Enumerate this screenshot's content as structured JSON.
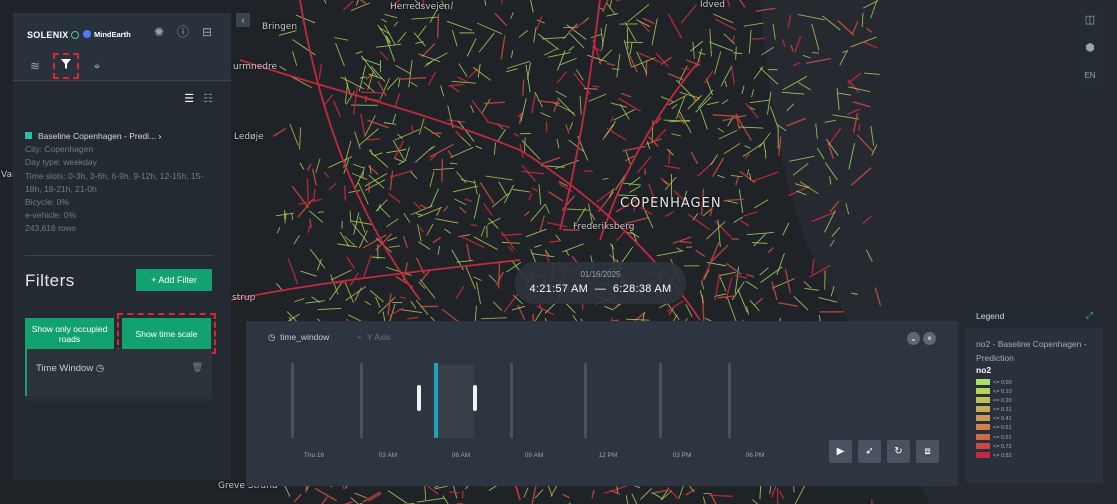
{
  "brand": {
    "name": "SOLENIX",
    "partner": "MindEarth"
  },
  "map": {
    "labels": [
      "Herredsvejen",
      "Bringen",
      "urmnedre",
      "Ledøje",
      "Valby",
      "COPENHAGEN",
      "Frederiksberg",
      "strup",
      "Greve Strand",
      "Idved"
    ]
  },
  "datasets": {
    "name": "Baseline Copenhagen - Predi...",
    "city": "City: Copenhagen",
    "day_type": "Day type: weekday",
    "time_slots": "Time slots: 0-3h, 3-6h, 6-9h, 9-12h, 12-15h, 15-18h, 18-21h, 21-0h",
    "bicycle": "Bicycle: 0%",
    "evehicle": "e-vehicle: 0%",
    "rows": "243,616 rows"
  },
  "filters": {
    "title": "Filters",
    "add_label": "Add Filter",
    "occupied_label": "Show only occupied roads",
    "timescale_label": "Show time scale",
    "time_window_label": "Time Window"
  },
  "time_overlay": {
    "date": "01/16/2025",
    "start": "4:21:57 AM",
    "end": "6:28:38 AM",
    "dash": "—"
  },
  "timeline": {
    "tab_field": "time_window",
    "tab_axis": "Y Axis",
    "tick_labels": [
      "Thu 16",
      "03 AM",
      "06 AM",
      "09 AM",
      "12 PM",
      "03 PM",
      "06 PM"
    ]
  },
  "right_controls": {
    "language": "EN"
  },
  "legend": {
    "title": "Legend",
    "dataset": "no2 - Baseline Copenhagen - Prediction",
    "metric": "no2",
    "items": [
      {
        "label": "<= 0.00",
        "color": "#a8e06a"
      },
      {
        "label": "<= 0.10",
        "color": "#b2d35c"
      },
      {
        "label": "<= 0.20",
        "color": "#bec255"
      },
      {
        "label": "<= 0.31",
        "color": "#c8ae52"
      },
      {
        "label": "<= 0.41",
        "color": "#cf9850"
      },
      {
        "label": "<= 0.51",
        "color": "#d1814c"
      },
      {
        "label": "<= 0.61",
        "color": "#cd6848"
      },
      {
        "label": "<= 0.72",
        "color": "#c84a44"
      },
      {
        "label": "<= 0.82",
        "color": "#c22a3f"
      }
    ]
  }
}
